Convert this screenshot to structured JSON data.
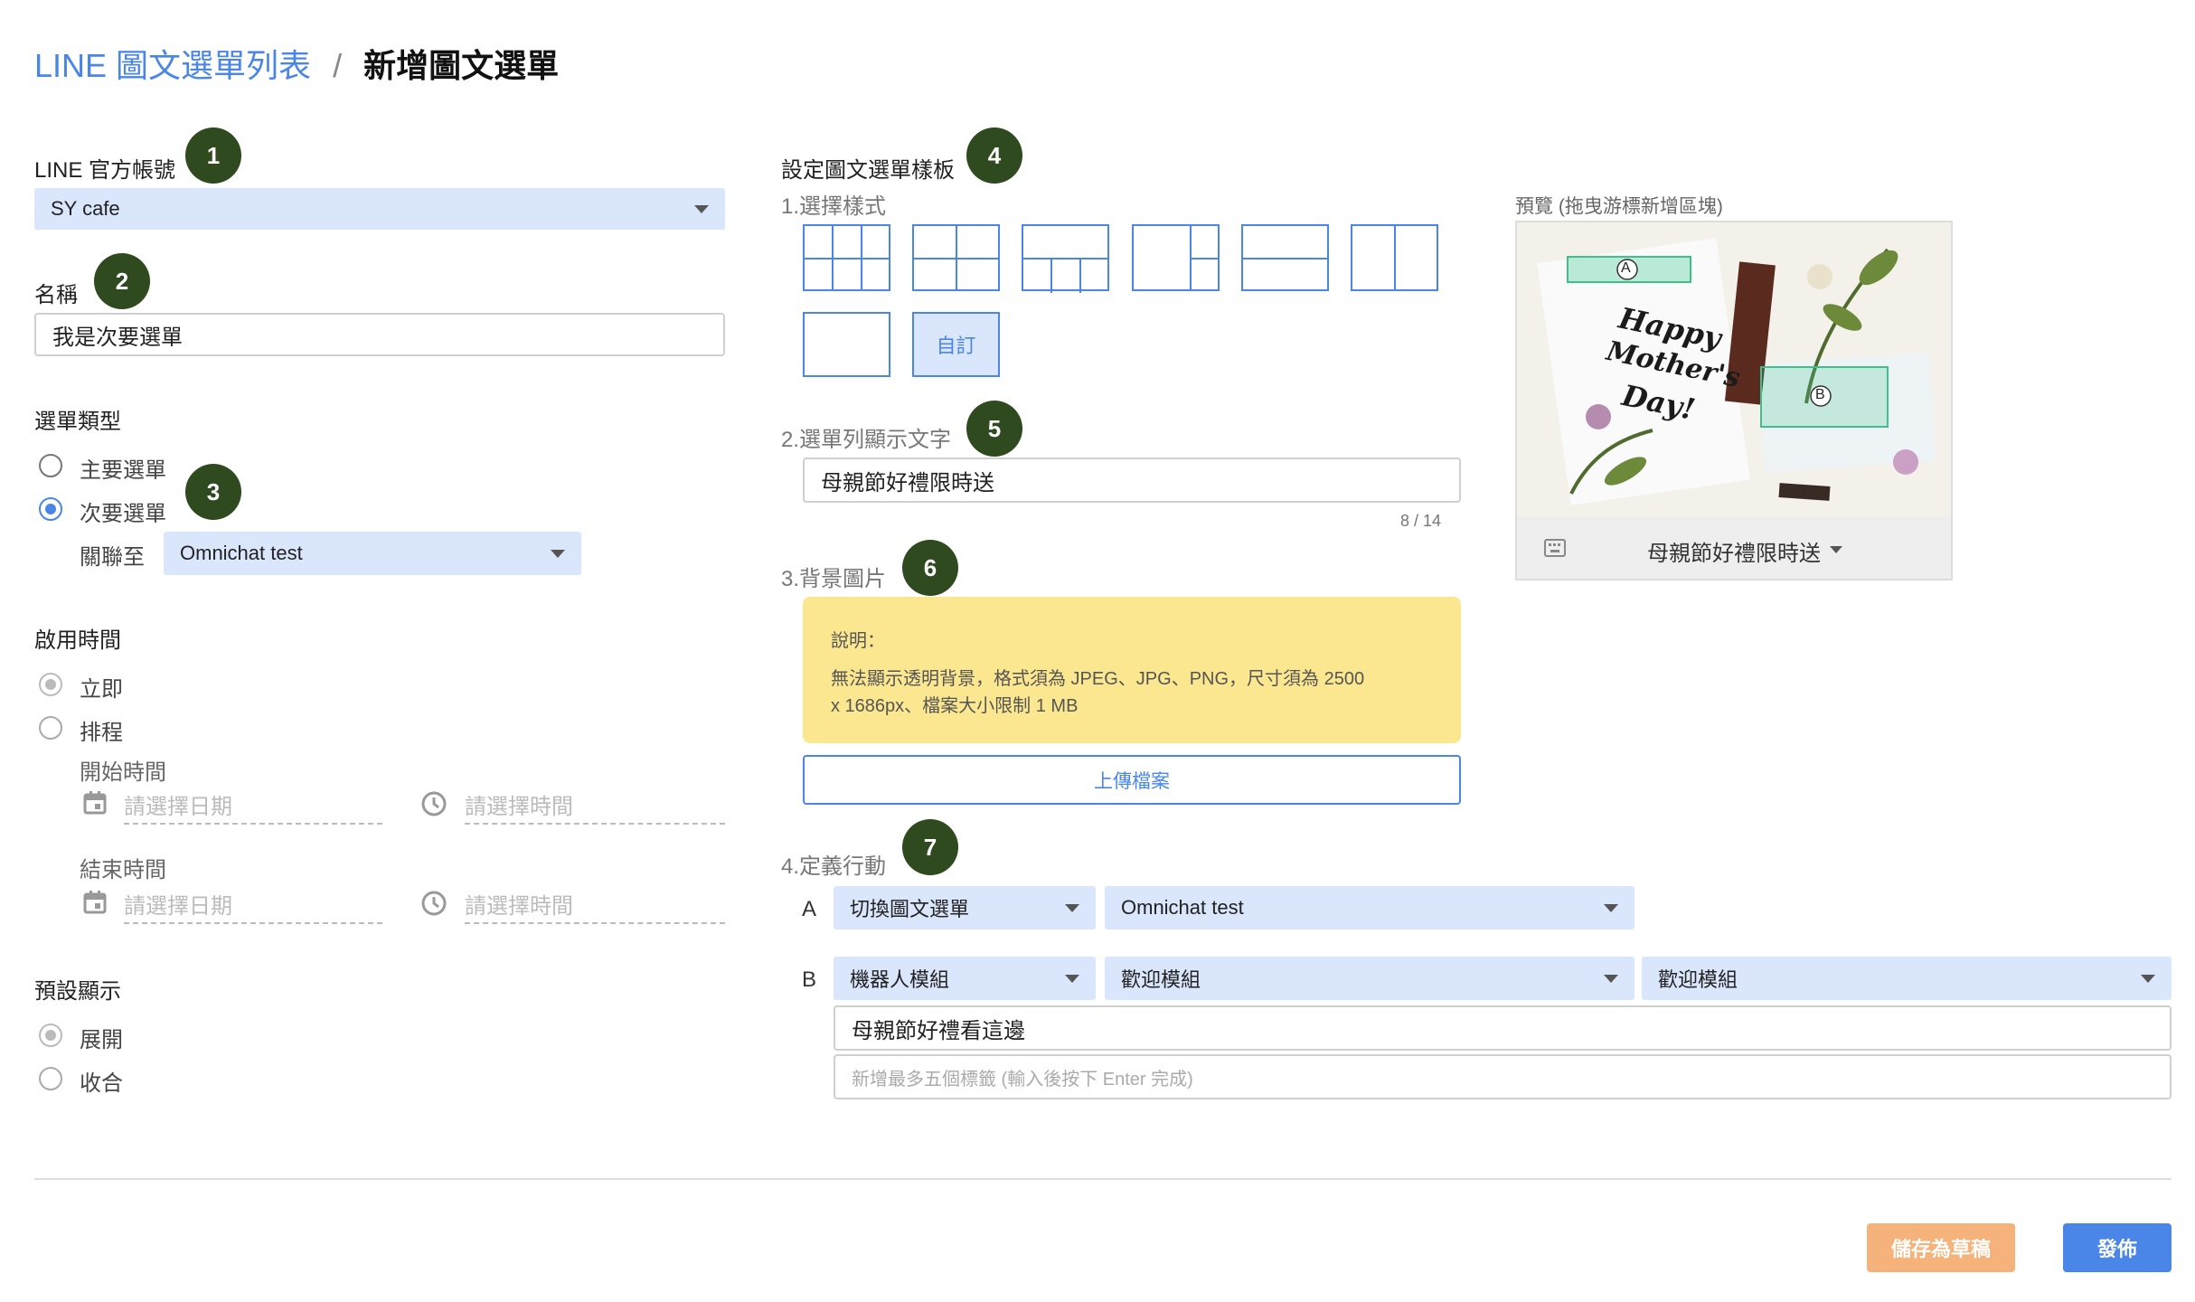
{
  "breadcrumb": {
    "parent": "LINE 圖文選單列表",
    "separator": "/",
    "current": "新增圖文選單"
  },
  "badges": [
    "1",
    "2",
    "3",
    "4",
    "5",
    "6",
    "7"
  ],
  "account": {
    "label": "LINE 官方帳號",
    "value": "SY cafe"
  },
  "name": {
    "label": "名稱",
    "value": "我是次要選單"
  },
  "menu_type": {
    "label": "選單類型",
    "options": [
      "主要選單",
      "次要選單"
    ],
    "selected": "次要選單",
    "link_label": "關聯至",
    "link_value": "Omnichat test"
  },
  "enable_time": {
    "label": "啟用時間",
    "options": [
      "立即",
      "排程"
    ],
    "start_label": "開始時間",
    "end_label": "結束時間",
    "date_placeholder": "請選擇日期",
    "time_placeholder": "請選擇時間"
  },
  "default_display": {
    "label": "預設顯示",
    "options": [
      "展開",
      "收合"
    ]
  },
  "template": {
    "label": "設定圖文選單樣板",
    "style_label": "1.選擇樣式",
    "custom_label": "自訂",
    "menubar_label": "2.選單列顯示文字",
    "menubar_value": "母親節好禮限時送",
    "char_count": "8 / 14",
    "bg_label": "3.背景圖片",
    "note_title": "說明：",
    "note_line1": "無法顯示透明背景，格式須為 JPEG、JPG、PNG，尺寸須為 2500",
    "note_line2": "x 1686px、檔案大小限制 1 MB",
    "upload_label": "上傳檔案",
    "action_label": "4.定義行動"
  },
  "actions": {
    "a": {
      "letter": "A",
      "type": "切換圖文選單",
      "target": "Omnichat test"
    },
    "b": {
      "letter": "B",
      "type": "機器人模組",
      "module": "歡迎模組",
      "sub": "歡迎模組",
      "text": "母親節好禮看這邊",
      "tags_placeholder": "新增最多五個標籤 (輸入後按下 Enter 完成)"
    }
  },
  "preview": {
    "label": "預覽 (拖曳游標新增區塊)",
    "area_a": "A",
    "area_b": "B",
    "art_text": [
      "Happy",
      "Mother's",
      "Day!"
    ],
    "menu_text": "母親節好禮限時送"
  },
  "footer": {
    "draft_label": "儲存為草稿",
    "publish_label": "發佈"
  },
  "colors": {
    "accent": "#4a86e8",
    "badge": "#2f4a1f",
    "draft": "#f5b27a",
    "note": "#fbe78f",
    "select": "#d9e6fb"
  }
}
